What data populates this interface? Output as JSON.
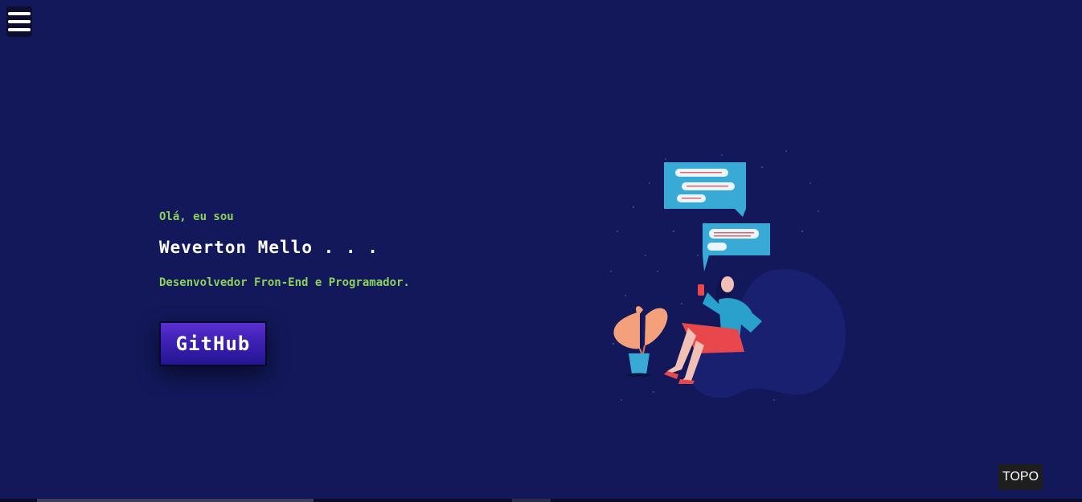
{
  "nav": {
    "menu_icon": "hamburger-menu-icon"
  },
  "hero": {
    "greeting": "Olá, eu sou",
    "name": "Weverton Mello . . .",
    "role": "Desenvolvedor Fron-End e Programador.",
    "github_label": "GitHub"
  },
  "footer": {
    "top_label": "TOPO"
  },
  "colors": {
    "background": "#12185a",
    "accent_green": "#8cd35c",
    "button_purple": "#3a1fb0",
    "chat_bubble": "#39a9d6"
  }
}
